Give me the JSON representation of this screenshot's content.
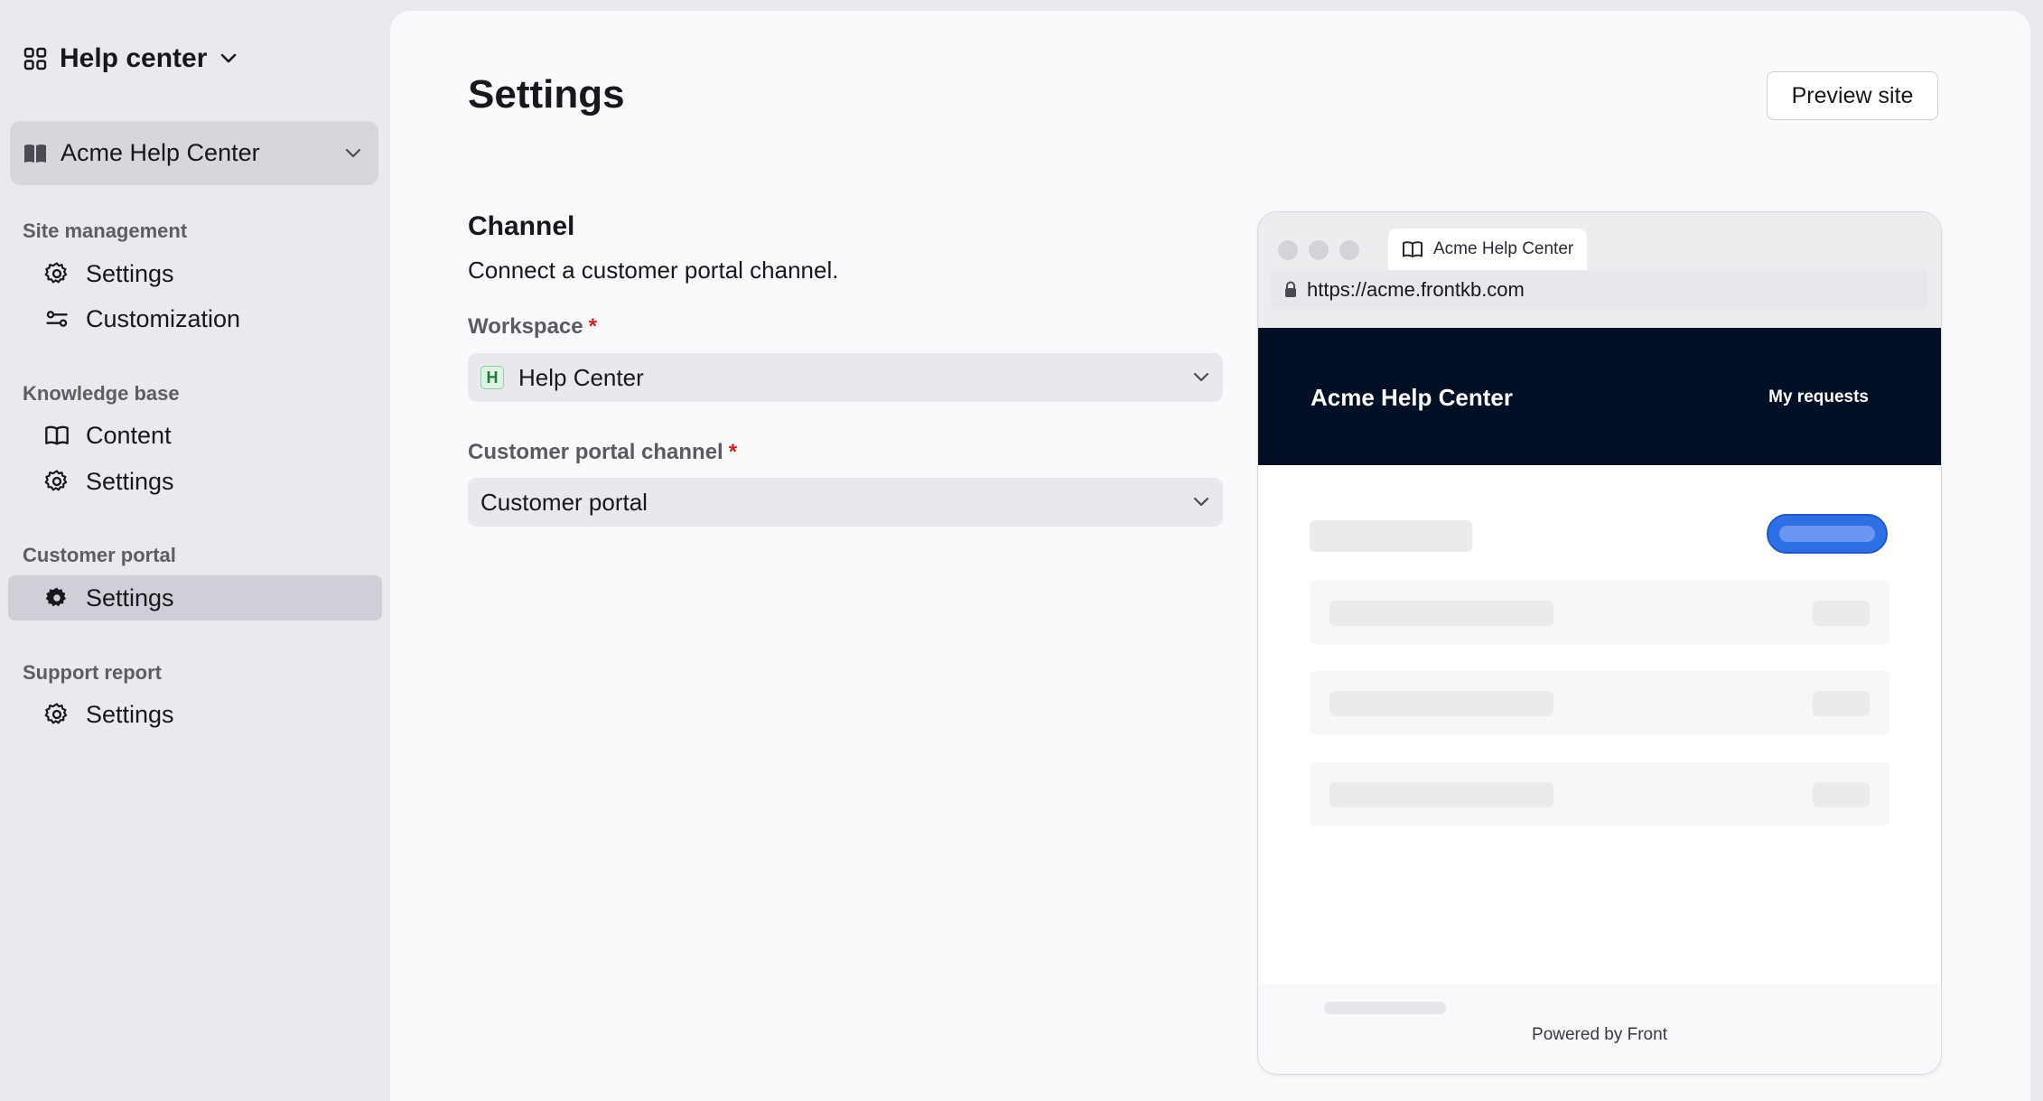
{
  "sidebar": {
    "app_switcher": {
      "label": "Help center"
    },
    "site_select": {
      "label": "Acme Help Center"
    },
    "sections": [
      {
        "title": "Site management",
        "items": [
          {
            "label": "Settings"
          },
          {
            "label": "Customization"
          }
        ]
      },
      {
        "title": "Knowledge base",
        "items": [
          {
            "label": "Content"
          },
          {
            "label": "Settings"
          }
        ]
      },
      {
        "title": "Customer portal",
        "items": [
          {
            "label": "Settings",
            "active": true
          }
        ]
      },
      {
        "title": "Support report",
        "items": [
          {
            "label": "Settings"
          }
        ]
      }
    ]
  },
  "main": {
    "title": "Settings",
    "preview_button": "Preview site",
    "channel": {
      "title": "Channel",
      "description": "Connect a customer portal channel.",
      "workspace": {
        "label": "Workspace",
        "required_mark": "*",
        "badge": "H",
        "value": "Help Center"
      },
      "portal_channel": {
        "label": "Customer portal channel",
        "required_mark": "*",
        "value": "Customer portal"
      }
    },
    "preview": {
      "tab_title": "Acme Help Center",
      "url": "https://acme.frontkb.com",
      "site_title": "Acme Help Center",
      "nav_link": "My requests",
      "footer": "Powered by Front",
      "accent_color": "#2f6fe6",
      "header_color": "#030f25"
    }
  }
}
